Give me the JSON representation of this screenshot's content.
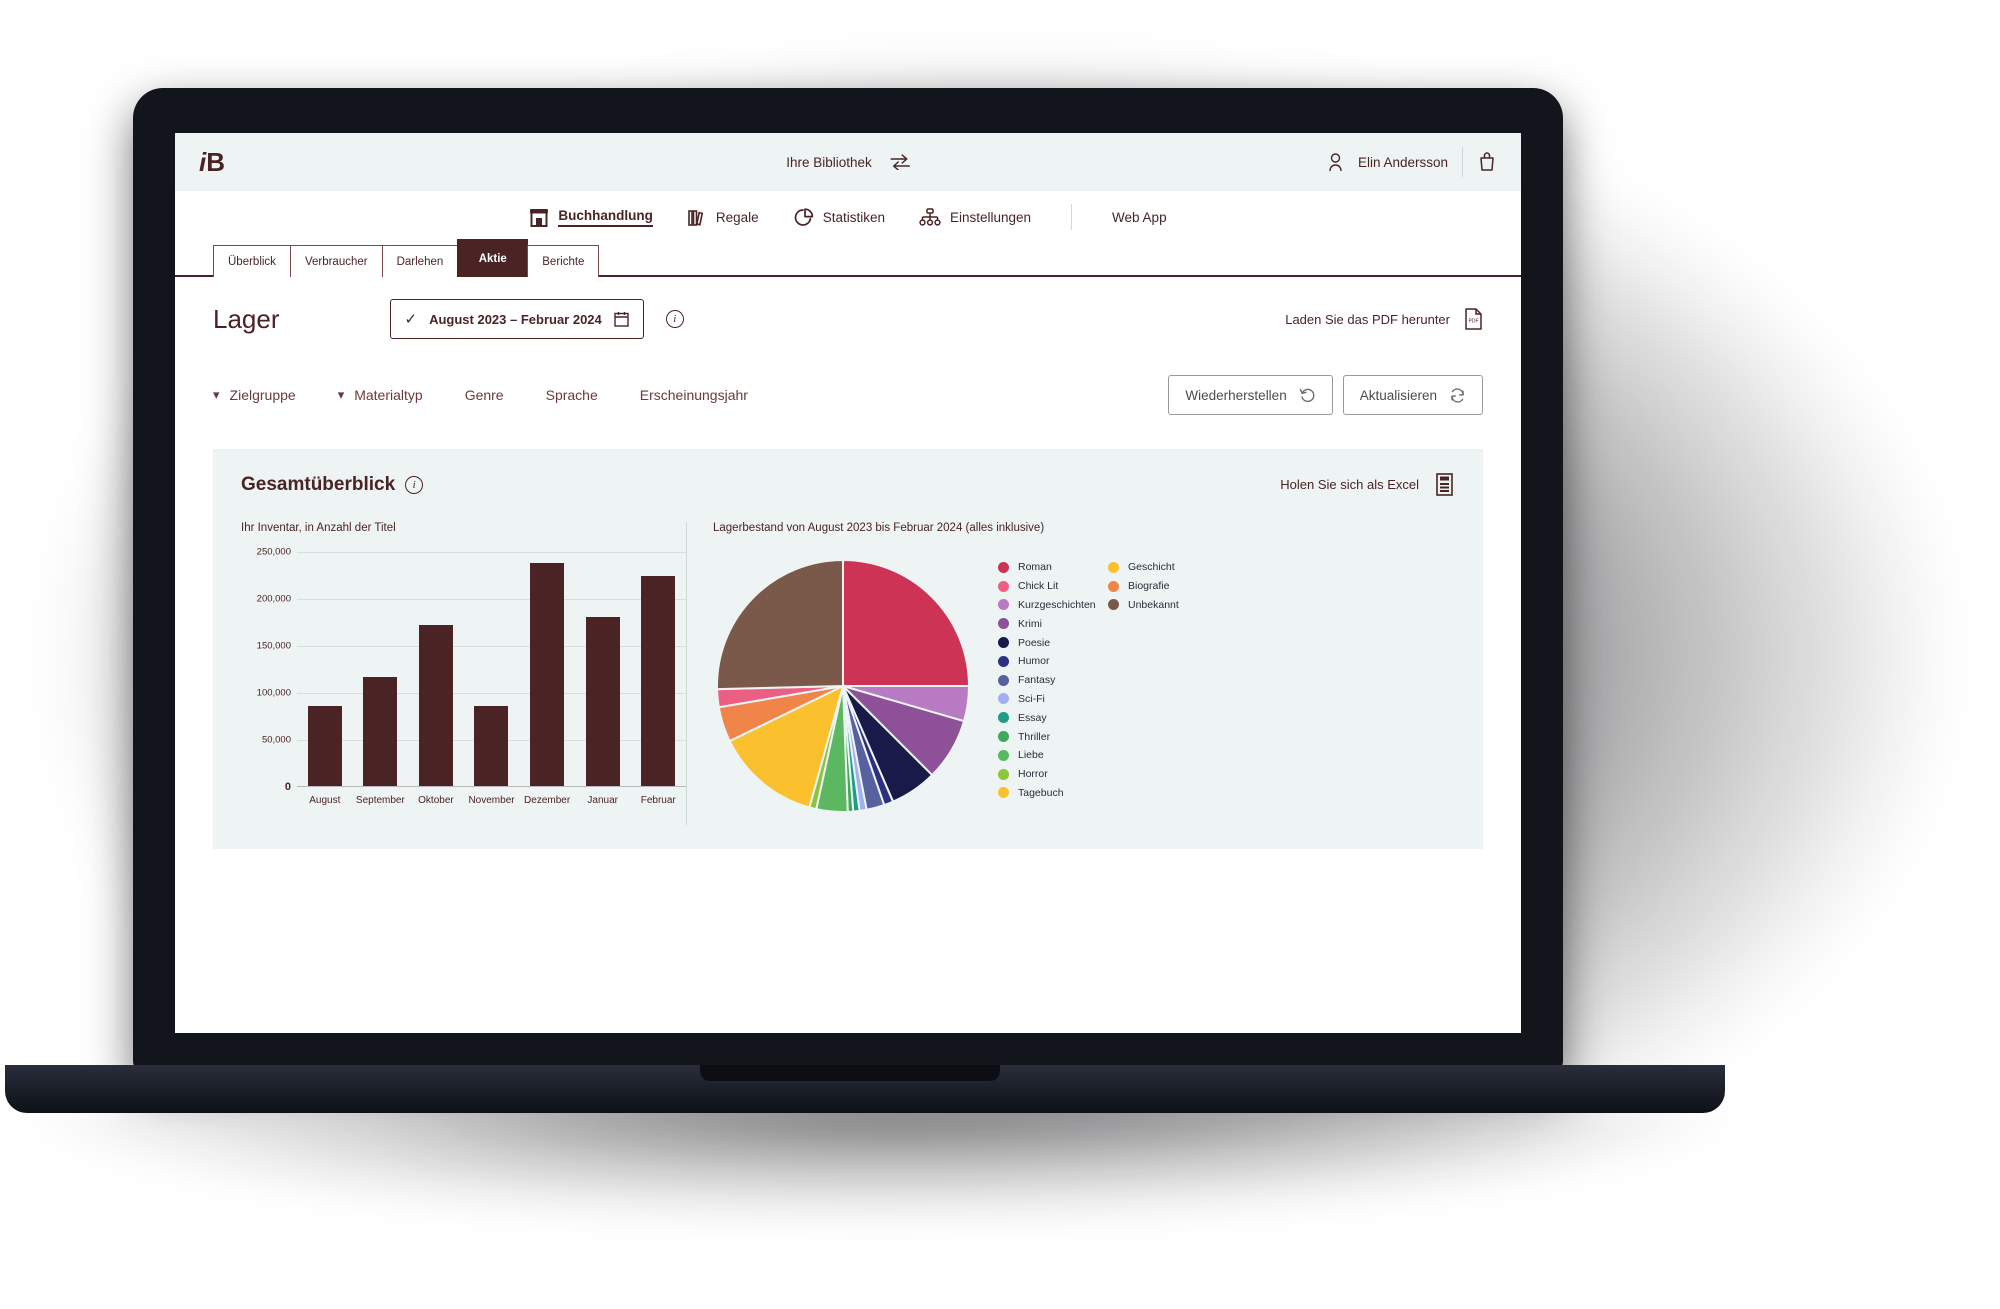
{
  "brand": {
    "logo_i": "i",
    "logo_b": "B"
  },
  "topbar": {
    "library_label": "Ihre Bibliothek",
    "switch_icon": "swap-arrows-icon",
    "user_name": "Elin Andersson",
    "user_icon": "user-icon",
    "basket_icon": "basket-icon"
  },
  "nav": {
    "items": [
      {
        "label": "Buchhandlung",
        "icon": "storefront-icon",
        "active": true
      },
      {
        "label": "Regale",
        "icon": "bookshelf-icon",
        "active": false
      },
      {
        "label": "Statistiken",
        "icon": "pie-chart-icon",
        "active": false
      },
      {
        "label": "Einstellungen",
        "icon": "sitemap-icon",
        "active": false
      }
    ],
    "extra": {
      "label": "Web App"
    }
  },
  "tabs": [
    {
      "label": "Überblick",
      "active": false
    },
    {
      "label": "Verbraucher",
      "active": false
    },
    {
      "label": "Darlehen",
      "active": false
    },
    {
      "label": "Aktie",
      "active": true
    },
    {
      "label": "Berichte",
      "active": false
    }
  ],
  "page": {
    "title": "Lager",
    "date_range": "August 2023 – Februar 2024",
    "date_check_icon": "check-icon",
    "calendar_icon": "calendar-icon",
    "info_icon": "info-icon",
    "pdf_label": "Laden Sie das PDF herunter",
    "pdf_icon": "pdf-file-icon"
  },
  "filters": {
    "items": [
      {
        "label": "Zielgruppe",
        "has_chevron": true
      },
      {
        "label": "Materialtyp",
        "has_chevron": true
      },
      {
        "label": "Genre",
        "has_chevron": false
      },
      {
        "label": "Sprache",
        "has_chevron": false
      },
      {
        "label": "Erscheinungsjahr",
        "has_chevron": false
      }
    ],
    "reset_label": "Wiederherstellen",
    "reset_icon": "undo-icon",
    "refresh_label": "Aktualisieren",
    "refresh_icon": "refresh-icon"
  },
  "card": {
    "title": "Gesamtüberblick",
    "title_info_icon": "info-icon",
    "excel_label": "Holen Sie sich als Excel",
    "excel_icon": "excel-file-icon",
    "left_caption": "Ihr Inventar, in Anzahl der Titel",
    "right_caption": "Lagerbestand von August 2023 bis Februar 2024 (alles inklusive)"
  },
  "colors": {
    "brand_maroon": "#4a2424",
    "panel_bg": "#eef4f3",
    "topbar_bg": "#eef4f3"
  },
  "chart_data": [
    {
      "type": "bar",
      "title": "Ihr Inventar, in Anzahl der Titel",
      "xlabel": "",
      "ylabel": "",
      "categories": [
        "August",
        "September",
        "Oktober",
        "November",
        "Dezember",
        "Januar",
        "Februar"
      ],
      "values": [
        85000,
        116000,
        171000,
        85000,
        237000,
        180000,
        223000
      ],
      "ylim": [
        0,
        250000
      ],
      "yticks": [
        0,
        50000,
        100000,
        150000,
        200000,
        250000
      ],
      "ytick_labels": [
        "0",
        "50,000",
        "100,000",
        "150,000",
        "200,000",
        "250,000"
      ],
      "grid": true,
      "bar_color": "#4a2424",
      "legend": "none"
    },
    {
      "type": "pie",
      "title": "Lagerbestand von August 2023 bis Februar 2024 (alles inklusive)",
      "legend_position": "right",
      "start_angle_deg": 0,
      "direction": "clockwise",
      "labels": [
        "Roman",
        "Kurzgeschichten",
        "Krimi",
        "Poesie",
        "Humor",
        "Fantasy",
        "Sci-Fi",
        "Essay",
        "Thriller",
        "Liebe",
        "Horror",
        "Tagebuch",
        "Biografie",
        "Chick Lit",
        "Unbekannt"
      ],
      "values": [
        25.0,
        4.5,
        8.0,
        6.0,
        1.2,
        2.3,
        0.9,
        0.8,
        0.7,
        4.0,
        0.9,
        13.5,
        4.5,
        2.3,
        25.4
      ],
      "colors": [
        "#cc3355",
        "#b97ac4",
        "#8e5098",
        "#181a4a",
        "#2b3080",
        "#56619e",
        "#a3aff0",
        "#1e9e8a",
        "#3fa85c",
        "#5cb860",
        "#8cc63f",
        "#fbc02d",
        "#f0854a",
        "#ec5f85",
        "#7a584a"
      ],
      "legend_entries": [
        {
          "label": "Roman",
          "color": "#cc3355"
        },
        {
          "label": "Chick Lit",
          "color": "#ec5f85"
        },
        {
          "label": "Kurzgeschichten",
          "color": "#b97ac4"
        },
        {
          "label": "Krimi",
          "color": "#8e5098"
        },
        {
          "label": "Poesie",
          "color": "#181a4a"
        },
        {
          "label": "Humor",
          "color": "#2b3080"
        },
        {
          "label": "Fantasy",
          "color": "#56619e"
        },
        {
          "label": "Sci-Fi",
          "color": "#a3aff0"
        },
        {
          "label": "Essay",
          "color": "#1e9e8a"
        },
        {
          "label": "Thriller",
          "color": "#3fa85c"
        },
        {
          "label": "Liebe",
          "color": "#5cb860"
        },
        {
          "label": "Horror",
          "color": "#8cc63f"
        },
        {
          "label": "Tagebuch",
          "color": "#fbc02d"
        },
        {
          "label": "Geschicht",
          "color": "#fbc02d"
        },
        {
          "label": "Biografie",
          "color": "#f0854a"
        },
        {
          "label": "Unbekannt",
          "color": "#7a584a"
        }
      ],
      "legend_col1": [
        "Roman",
        "Chick Lit",
        "Kurzgeschichten",
        "Krimi",
        "Poesie",
        "Humor",
        "Fantasy",
        "Sci-Fi",
        "Essay",
        "Thriller",
        "Liebe",
        "Horror",
        "Tagebuch"
      ],
      "legend_col2": [
        "Geschicht",
        "Biografie",
        "Unbekannt"
      ]
    }
  ]
}
